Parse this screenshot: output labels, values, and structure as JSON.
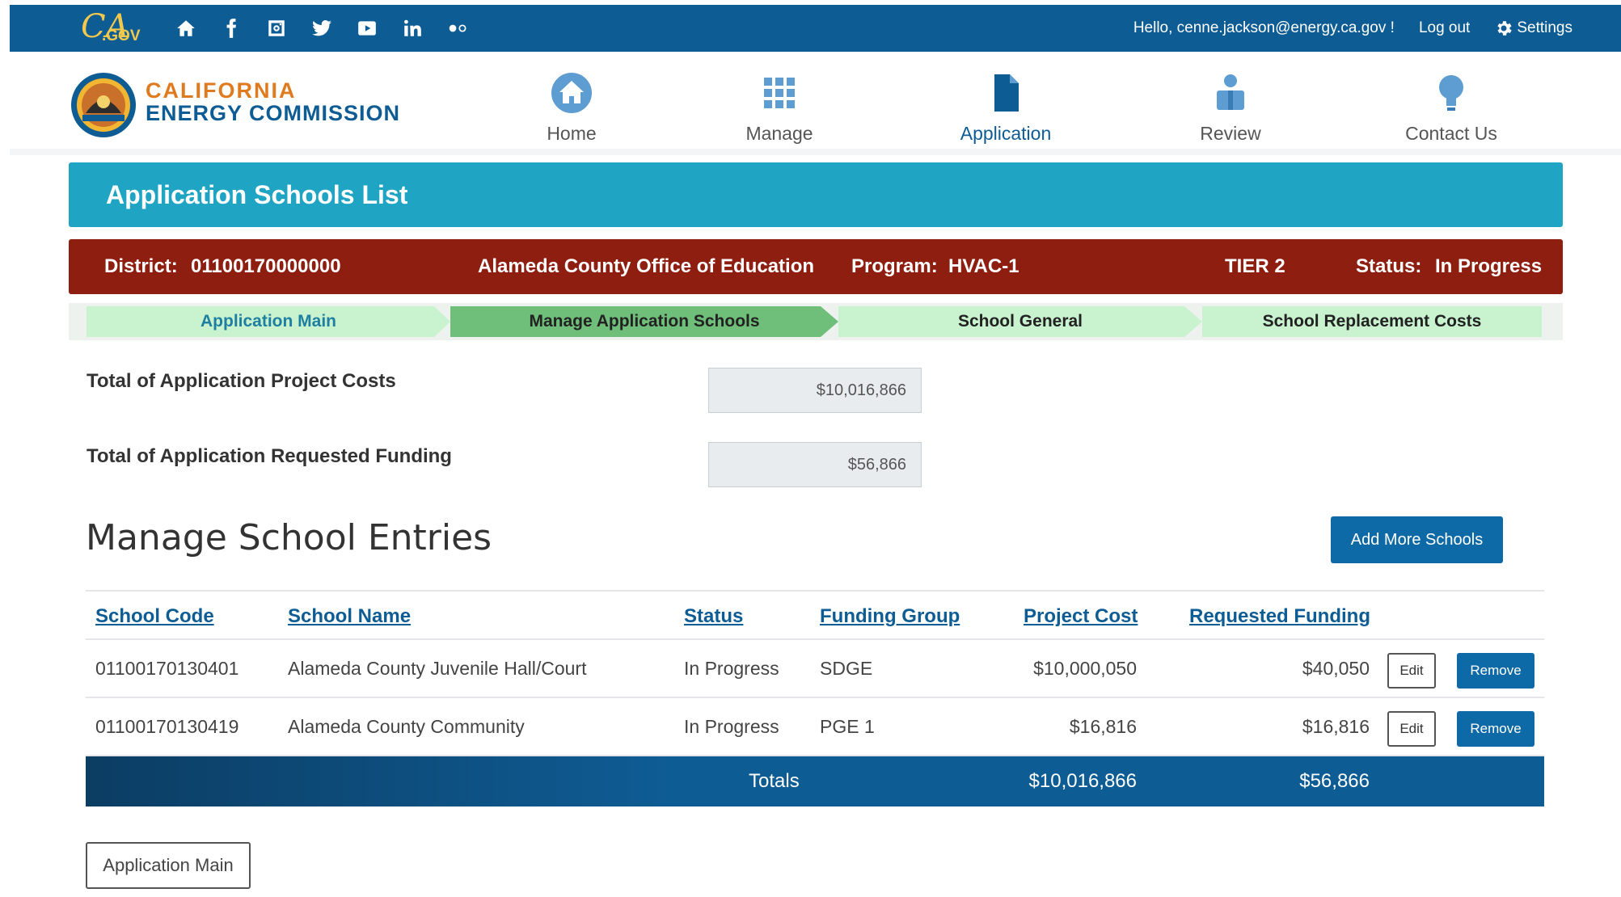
{
  "topbar": {
    "logo_text": "CA",
    "logo_sub": ".GOV",
    "social": [
      "home-icon",
      "facebook-icon",
      "instagram-icon",
      "twitter-icon",
      "youtube-icon",
      "linkedin-icon",
      "flickr-icon"
    ],
    "greeting": "Hello, cenne.jackson@energy.ca.gov !",
    "logout": "Log out",
    "settings": "Settings"
  },
  "header": {
    "org_line1": "CALIFORNIA",
    "org_line2": "ENERGY COMMISSION",
    "nav": [
      {
        "label": "Home",
        "icon": "house-icon"
      },
      {
        "label": "Manage",
        "icon": "grid-icon"
      },
      {
        "label": "Application",
        "icon": "document-icon",
        "active": true
      },
      {
        "label": "Review",
        "icon": "review-icon"
      },
      {
        "label": "Contact Us",
        "icon": "lightbulb-icon"
      }
    ]
  },
  "page": {
    "title": "Application Schools List"
  },
  "district": {
    "label": "District:",
    "code": "01100170000000",
    "name": "Alameda County Office of Education",
    "program_label": "Program:",
    "program": "HVAC-1",
    "tier": "TIER 2",
    "status_label": "Status:",
    "status": "In Progress"
  },
  "steps": [
    {
      "label": "Application Main",
      "state": "link"
    },
    {
      "label": "Manage Application Schools",
      "state": "current"
    },
    {
      "label": "School General",
      "state": "normal"
    },
    {
      "label": "School Replacement Costs",
      "state": "normal"
    }
  ],
  "totals_fields": {
    "project_costs_label": "Total of Application Project Costs",
    "project_costs_value": "$10,016,866",
    "requested_funding_label": "Total of Application Requested Funding",
    "requested_funding_value": "$56,866"
  },
  "section": {
    "title": "Manage School Entries",
    "add_button": "Add More Schools"
  },
  "table": {
    "headers": {
      "school_code": "School Code",
      "school_name": "School Name",
      "status": "Status",
      "funding_group": "Funding Group",
      "project_cost": "Project Cost",
      "requested_funding": "Requested Funding"
    },
    "rows": [
      {
        "school_code": "01100170130401",
        "school_name": "Alameda County Juvenile Hall/Court",
        "status": "In Progress",
        "funding_group": "SDGE",
        "project_cost": "$10,000,050",
        "requested_funding": "$40,050",
        "edit": "Edit",
        "remove": "Remove"
      },
      {
        "school_code": "01100170130419",
        "school_name": "Alameda County Community",
        "status": "In Progress",
        "funding_group": "PGE 1",
        "project_cost": "$16,816",
        "requested_funding": "$16,816",
        "edit": "Edit",
        "remove": "Remove"
      }
    ],
    "totals": {
      "label": "Totals",
      "project_cost": "$10,016,866",
      "requested_funding": "$56,866"
    }
  },
  "footer": {
    "app_main_button": "Application Main"
  },
  "colors": {
    "topbar": "#0e5c94",
    "title_bar": "#1fa4c4",
    "district_bar": "#8e1e10",
    "step_light": "#c9f2cf",
    "step_current": "#6fbf7a",
    "link": "#0e5c94",
    "button": "#0e6aa6"
  }
}
